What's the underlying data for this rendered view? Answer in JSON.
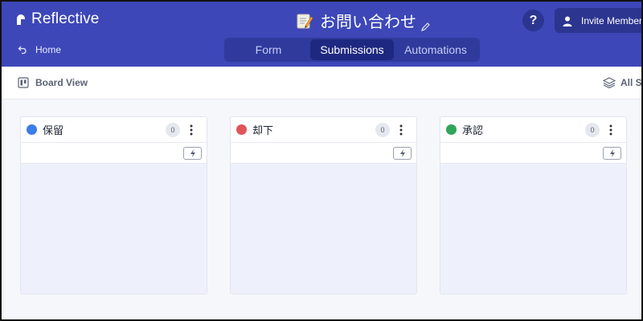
{
  "header": {
    "app_name": "Reflective",
    "page_title": "お問い合わせ",
    "help_label": "?",
    "invite_label": "Invite Members",
    "home_label": "Home",
    "tabs": [
      {
        "label": "Form"
      },
      {
        "label": "Submissions"
      },
      {
        "label": "Automations"
      }
    ],
    "active_tab": "Submissions",
    "colors": {
      "bar": "#3d47b8",
      "tab_track": "#2f3a9c",
      "tab_active": "#1f2880"
    }
  },
  "toolbar": {
    "view_label": "Board View",
    "filter_label": "All Su"
  },
  "board": {
    "columns": [
      {
        "title": "保留",
        "count": "0",
        "color": "#3b7de9"
      },
      {
        "title": "却下",
        "count": "0",
        "color": "#e0555a"
      },
      {
        "title": "承認",
        "count": "0",
        "color": "#2fa55a"
      }
    ]
  },
  "icons": [
    "logo-icon",
    "memo-icon",
    "pencil-icon",
    "user-icon",
    "back-arrow-icon",
    "board-icon",
    "layers-icon",
    "more-vertical-icon",
    "lightning-icon"
  ]
}
